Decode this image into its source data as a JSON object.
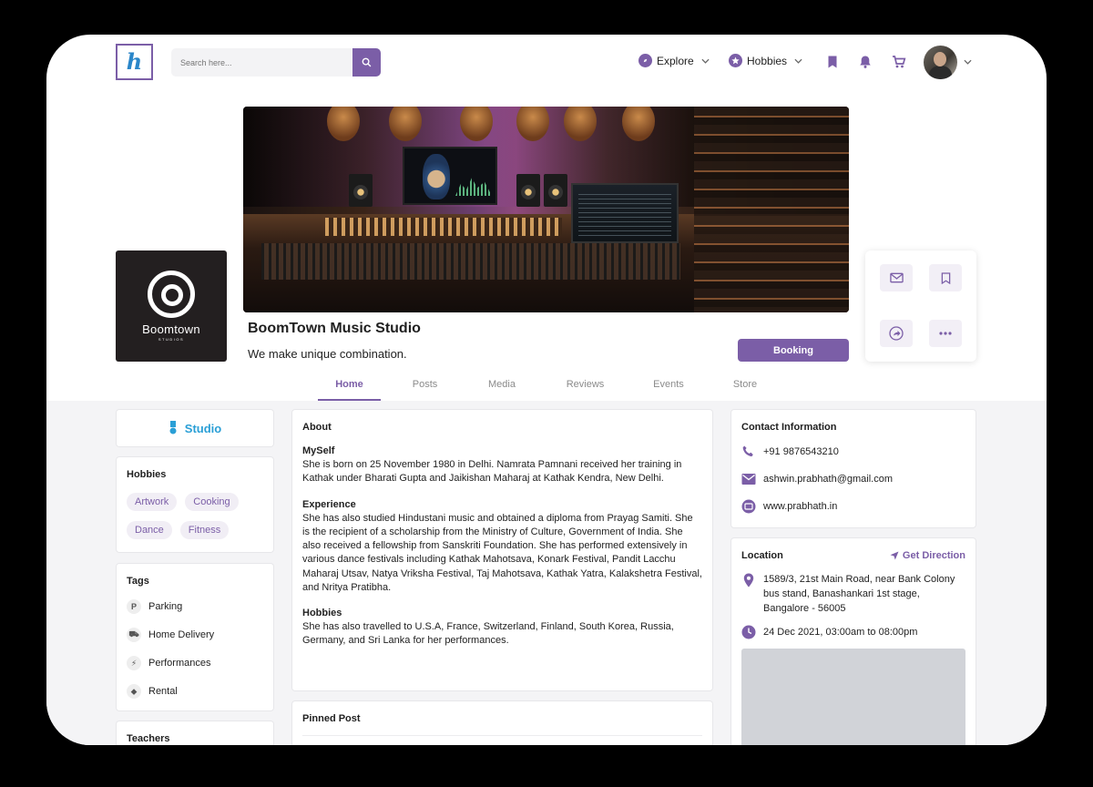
{
  "header": {
    "logo_letter": "h",
    "search_placeholder": "Search here...",
    "nav": [
      {
        "label": "Explore",
        "icon": "compass-icon"
      },
      {
        "label": "Hobbies",
        "icon": "star-icon"
      }
    ],
    "icons": [
      "bookmark-icon",
      "bell-icon",
      "cart-icon"
    ],
    "accent": "#7b5ea7"
  },
  "profile": {
    "logo_title": "Boomtown",
    "logo_subtitle": "STUDIOS",
    "name": "BoomTown Music Studio",
    "tagline": "We make unique combination.",
    "booking_label": "Booking",
    "actions": [
      "mail-icon",
      "bookmark-icon",
      "share-icon",
      "more-icon"
    ]
  },
  "tabs": [
    {
      "label": "Home",
      "active": true
    },
    {
      "label": "Posts",
      "active": false
    },
    {
      "label": "Media",
      "active": false
    },
    {
      "label": "Reviews",
      "active": false
    },
    {
      "label": "Events",
      "active": false
    },
    {
      "label": "Store",
      "active": false
    }
  ],
  "sidebar": {
    "category": "Studio",
    "hobbies_title": "Hobbies",
    "hobbies": [
      "Artwork",
      "Cooking",
      "Dance",
      "Fitness"
    ],
    "tags_title": "Tags",
    "tags": [
      {
        "label": "Parking",
        "icon": "parking-icon",
        "glyph": "P"
      },
      {
        "label": "Home Delivery",
        "icon": "delivery-icon",
        "glyph": "⛟"
      },
      {
        "label": "Performances",
        "icon": "bolt-icon",
        "glyph": "⚡"
      },
      {
        "label": "Rental",
        "icon": "tag-icon",
        "glyph": "⬥"
      }
    ],
    "teachers_title": "Teachers"
  },
  "about": {
    "title": "About",
    "sections": [
      {
        "heading": "MySelf",
        "text": "She is born on 25 November 1980 in Delhi. Namrata Pamnani received her training in Kathak under Bharati Gupta and Jaikishan Maharaj at Kathak Kendra, New Delhi."
      },
      {
        "heading": "Experience",
        "text": "She has also studied Hindustani music and obtained a diploma from Prayag Samiti. She is the recipient of a scholarship from the Ministry of Culture, Government of India. She also received a fellowship from Sanskriti Foundation. She has performed extensively in various dance festivals including Kathak Mahotsava, Konark Festival, Pandit Lacchu Maharaj Utsav, Natya Vriksha Festival, Taj Mahotsava, Kathak Yatra, Kalakshetra Festival, and Nritya Pratibha."
      },
      {
        "heading": "Hobbies",
        "text": "She has also travelled to U.S.A, France, Switzerland, Finland, South Korea, Russia, Germany, and Sri Lanka for her performances."
      }
    ],
    "pinned_title": "Pinned Post"
  },
  "contact": {
    "title": "Contact Information",
    "phone": "+91 9876543210",
    "email": "ashwin.prabhath@gmail.com",
    "website": "www.prabhath.in"
  },
  "location": {
    "title": "Location",
    "direction_label": "Get Direction",
    "address": "1589/3, 21st Main Road, near Bank Colony bus stand, Banashankari 1st stage, Bangalore - 56005",
    "datetime": "24 Dec 2021, 03:00am to 08:00pm"
  }
}
